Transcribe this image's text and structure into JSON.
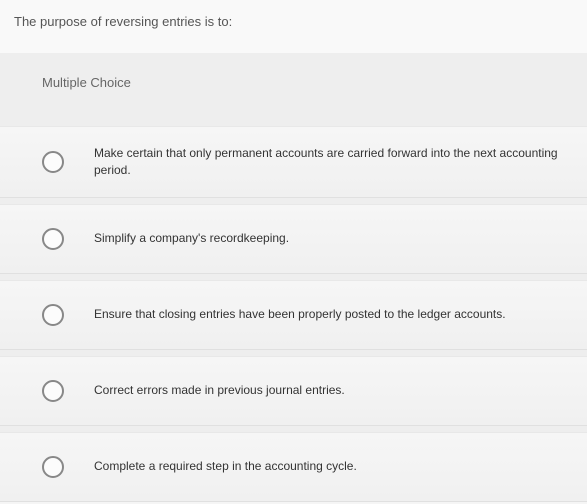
{
  "question": {
    "prompt": "The purpose of reversing entries is to:",
    "type_label": "Multiple Choice"
  },
  "options": [
    {
      "text": "Make certain that only permanent accounts are carried forward into the next accounting period."
    },
    {
      "text": "Simplify a company's recordkeeping."
    },
    {
      "text": "Ensure that closing entries have been properly posted to the ledger accounts."
    },
    {
      "text": "Correct errors made in previous journal entries."
    },
    {
      "text": "Complete a required step in the accounting cycle."
    }
  ]
}
